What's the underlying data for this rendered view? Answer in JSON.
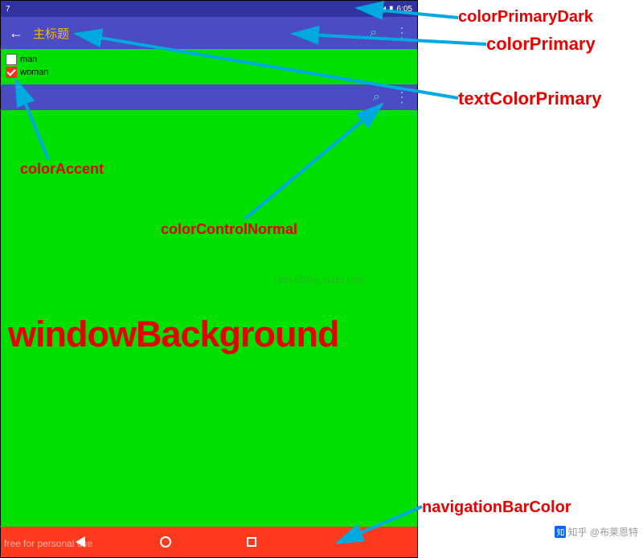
{
  "statusBar": {
    "leftIcon": "7",
    "time": "6:05",
    "batteryIcon": "▮"
  },
  "toolbar1": {
    "title": "主标题",
    "searchIcon": "⌕",
    "moreIcon": "⋮"
  },
  "checkboxes": {
    "item1": {
      "label": "man",
      "checked": false
    },
    "item2": {
      "label": "woman",
      "checked": true
    }
  },
  "toolbar2": {
    "searchIcon": "⌕",
    "moreIcon": "⋮"
  },
  "watermark": {
    "url": "http://blog.csdn.net/",
    "zhihu": "知乎 @布莱恩特",
    "freeUse": "free for personal use"
  },
  "annotations": {
    "colorPrimaryDark": "colorPrimaryDark",
    "colorPrimary": "colorPrimary",
    "textColorPrimary": "textColorPrimary",
    "colorAccent": "colorAccent",
    "colorControlNormal": "colorControlNormal",
    "windowBackground": "windowBackground",
    "navigationBarColor": "navigationBarColor"
  },
  "colors": {
    "colorPrimaryDark": "#3232a0",
    "colorPrimary": "#4b4bc4",
    "textColorPrimary": "#ffb300",
    "colorAccent": "#ff3020",
    "colorControlNormal": "#5fc9e8",
    "windowBackground": "#00e000",
    "navigationBarColor": "#ff3a1f",
    "annotationText": "#e60000",
    "arrows": "#00a8e0"
  }
}
